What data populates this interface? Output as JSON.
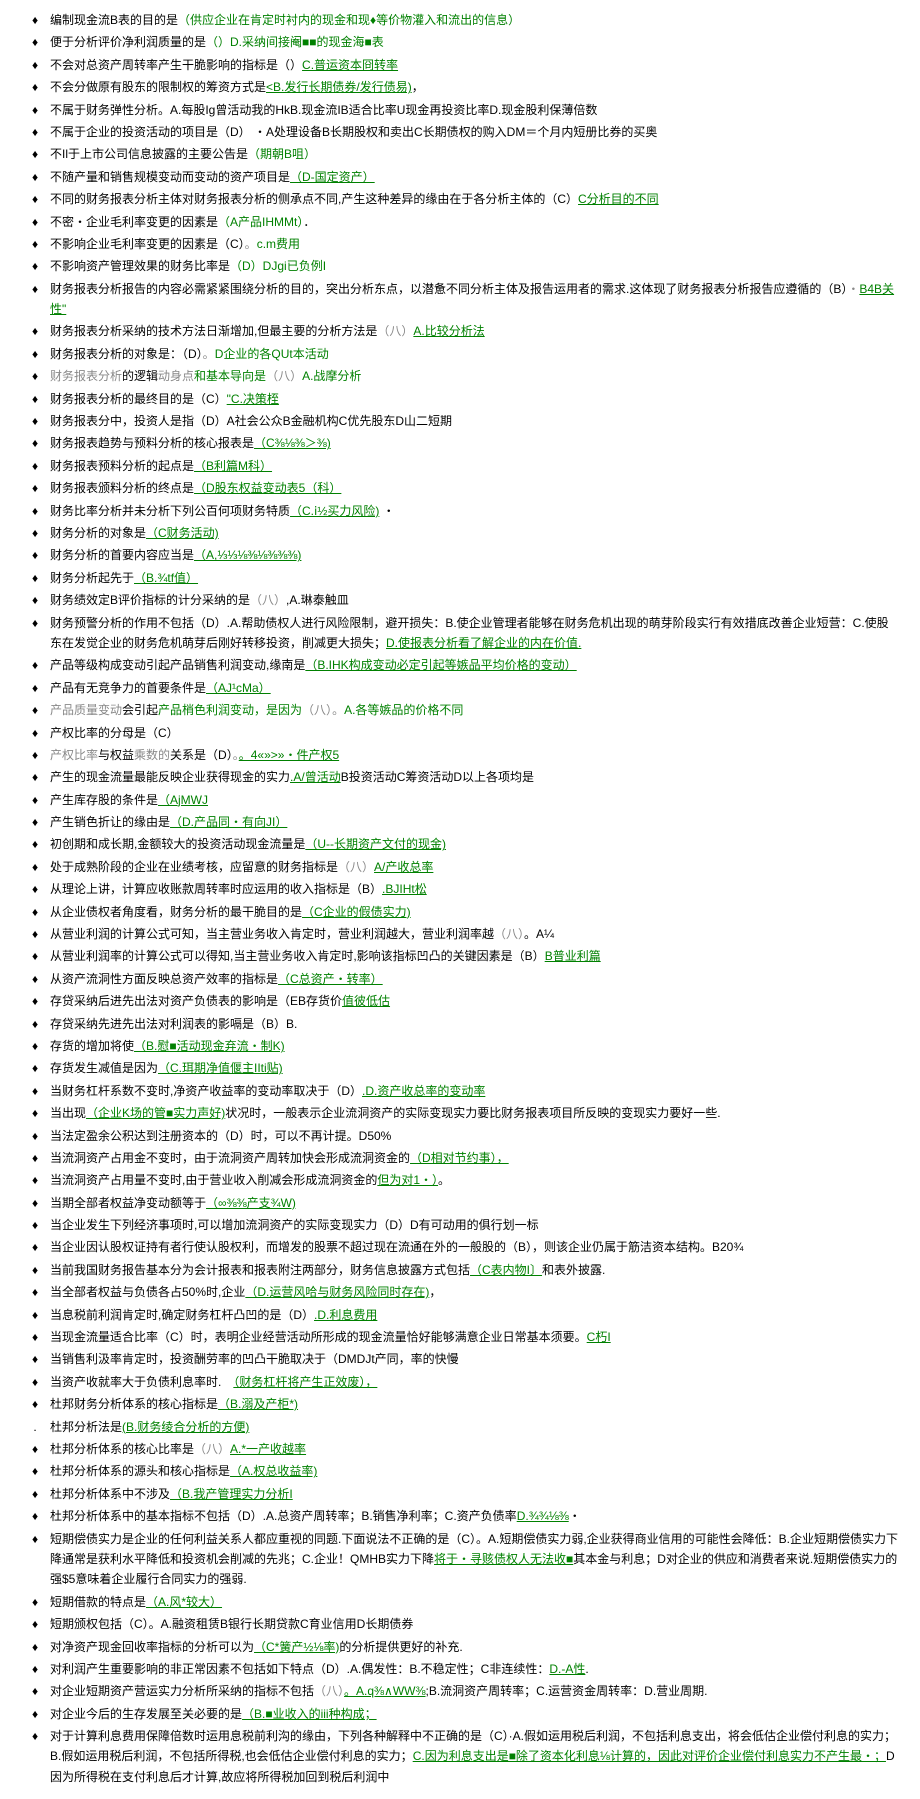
{
  "lines": [
    {
      "bullet": "♦",
      "parts": [
        {
          "t": "编制现金流B表的目的是",
          "c": "black"
        },
        {
          "t": "（供应企业在肯定时衬内的现金和现♦等价物灌入和流出的信息）",
          "c": "green"
        }
      ]
    },
    {
      "bullet": "♦",
      "parts": [
        {
          "t": "便于分析评价净利润质量的是",
          "c": "black"
        },
        {
          "t": "（）D.采纳间接阉■■的现金海■表",
          "c": "green"
        }
      ]
    },
    {
      "bullet": "♦",
      "parts": [
        {
          "t": "不会对总资产周转率产生干脆影响的指标是",
          "c": "black"
        },
        {
          "t": "（）",
          "c": "black"
        },
        {
          "t": "C.普运资本冏转率",
          "c": "green-u"
        }
      ]
    },
    {
      "bullet": "♦",
      "parts": [
        {
          "t": "不会分做原有股东的限制权的筹资方式是",
          "c": "black"
        },
        {
          "t": "<B.发行长期债券/发行债易)",
          "c": "green-u"
        },
        {
          "t": "，",
          "c": "black"
        }
      ]
    },
    {
      "bullet": "♦",
      "parts": [
        {
          "t": "不属于财务弹性分析。A.每股Ig曾活动我的HkB.现金流IB适合比率U现金再投资比率D.现金股利保薄倍数",
          "c": "black"
        }
      ]
    },
    {
      "bullet": "♦",
      "parts": [
        {
          "t": "不属于企业的投资活动的项目是（D）  ・A处理设备B长期股权和卖出C长期债权的购入DM＝个月内短册比券的买奥",
          "c": "black"
        }
      ]
    },
    {
      "bullet": "♦",
      "parts": [
        {
          "t": "不Il于上市公司信息披露的主要公告是",
          "c": "black"
        },
        {
          "t": "（期朝B咀）",
          "c": "green"
        }
      ]
    },
    {
      "bullet": "♦",
      "parts": [
        {
          "t": "不随产量和销售规模变动而变动的资产项目是",
          "c": "black"
        },
        {
          "t": "（D-国定资产）",
          "c": "green-u"
        }
      ]
    },
    {
      "bullet": "♦",
      "parts": [
        {
          "t": "不同的财务报表分析主体对财务报表分析的侧承点不同,产生这种差异的缘由在于各分析主体的（C）",
          "c": "black"
        },
        {
          "t": "C分析目的不同",
          "c": "green-u"
        }
      ]
    },
    {
      "bullet": "♦",
      "parts": [
        {
          "t": "不密・企业毛利率变更的因素是",
          "c": "black"
        },
        {
          "t": "（A产品IHMMt）",
          "c": "green"
        },
        {
          "t": "．",
          "c": "black"
        }
      ]
    },
    {
      "bullet": "♦",
      "parts": [
        {
          "t": "不影响企业毛利率变更的因素是（C）",
          "c": "black"
        },
        {
          "t": "。",
          "c": "gray"
        },
        {
          "t": "c.m费用",
          "c": "green"
        }
      ]
    },
    {
      "bullet": "♦",
      "parts": [
        {
          "t": "不影响资产管理效果的财务比率是",
          "c": "black"
        },
        {
          "t": "（D）DJgi已负例I",
          "c": "green"
        }
      ]
    },
    {
      "bullet": "♦",
      "parts": [
        {
          "t": "财务报表分析报告的内容必需紧紧围绕分析的目的，突出分析东点，以潜惫不同分析主体及报告运用者的需求.这体现了财务报表分析报告应遵循的（B）",
          "c": "black"
        },
        {
          "t": "・",
          "c": "gray"
        },
        {
          "t": "B4B关性\"",
          "c": "green-u"
        }
      ]
    },
    {
      "bullet": "♦",
      "parts": [
        {
          "t": "财务报表分析采纳的技术方法日渐增加,但最主要的分析方法是",
          "c": "black"
        },
        {
          "t": "（八）",
          "c": "gray"
        },
        {
          "t": "A.比较分析法",
          "c": "green-u"
        }
      ]
    },
    {
      "bullet": "♦",
      "parts": [
        {
          "t": "财务报表分析的对象是：（D）",
          "c": "black"
        },
        {
          "t": "。",
          "c": "gray"
        },
        {
          "t": "D企业的各QUt本活动",
          "c": "green"
        }
      ]
    },
    {
      "bullet": "♦",
      "parts": [
        {
          "t": "财务报表分析",
          "c": "gray"
        },
        {
          "t": "的逻辑",
          "c": "black"
        },
        {
          "t": "动身点",
          "c": "gray"
        },
        {
          "t": "和基本导向是",
          "c": "green"
        },
        {
          "t": "（八）",
          "c": "gray"
        },
        {
          "t": "A.战摩分析",
          "c": "green"
        }
      ]
    },
    {
      "bullet": "♦",
      "parts": [
        {
          "t": "财务报表分析的最终目的是（C）",
          "c": "black"
        },
        {
          "t": "\"C.决策桎",
          "c": "green-u"
        }
      ]
    },
    {
      "bullet": "♦",
      "parts": [
        {
          "t": "财务报表分中，投资人是指（D）A社会公众B金融机构C优先股东D山二短期",
          "c": "black"
        }
      ]
    },
    {
      "bullet": "♦",
      "parts": [
        {
          "t": "财务报表趋势与预料分析的核心报表是",
          "c": "black"
        },
        {
          "t": "（C⅜⅛⅜＞⅜)",
          "c": "green-u"
        }
      ]
    },
    {
      "bullet": "♦",
      "parts": [
        {
          "t": "财务报表预料分析的起点是",
          "c": "black"
        },
        {
          "t": "（B利篇M科）",
          "c": "green-u"
        }
      ]
    },
    {
      "bullet": "♦",
      "parts": [
        {
          "t": "财务报表颁料分析的终点是",
          "c": "black"
        },
        {
          "t": "（D股东权益变动表5（科）",
          "c": "green-u"
        }
      ]
    },
    {
      "bullet": "♦",
      "parts": [
        {
          "t": "财务比率分析并未分析下列公百何项财务特质",
          "c": "black"
        },
        {
          "t": "（C.ⅰ½买力风险)",
          "c": "green-u"
        },
        {
          "t": "  ・",
          "c": "black"
        }
      ]
    },
    {
      "bullet": "♦",
      "parts": [
        {
          "t": "财务分析的对象是",
          "c": "black"
        },
        {
          "t": "（C财务活动)",
          "c": "green-u"
        }
      ]
    },
    {
      "bullet": "♦",
      "parts": [
        {
          "t": "财务分析的首要内容应当是",
          "c": "black"
        },
        {
          "t": "（A,⅓⅓⅛⅜⅛⅜⅜⅜)",
          "c": "green-u"
        }
      ]
    },
    {
      "bullet": "♦",
      "parts": [
        {
          "t": "财务分析起先于",
          "c": "black"
        },
        {
          "t": "（B.¾tf值）",
          "c": "green-u"
        }
      ]
    },
    {
      "bullet": "♦",
      "parts": [
        {
          "t": "财务绩效定B评价指标的计分采纳的是",
          "c": "black"
        },
        {
          "t": "（八）",
          "c": "gray"
        },
        {
          "t": ",A.琳泰触皿",
          "c": "black"
        }
      ]
    },
    {
      "bullet": "♦",
      "parts": [
        {
          "t": "财务预警分析的作用不包括（D）.A.帮助债权人进行风险限制，避开损失：B.使企业管理者能够在财务危机出现的萌芽阶段实行有效措底改善企业短营：C.使股东在发觉企业的财务危机萌芽后刚好转移投资，削减更大损失；",
          "c": "black"
        },
        {
          "t": "D.使报表分析看了解企业的内在价值.",
          "c": "green-u"
        }
      ]
    },
    {
      "bullet": "♦",
      "parts": [
        {
          "t": "产品等级构成变动引起产品销售利润变动,缘南是",
          "c": "black"
        },
        {
          "t": "（B.IHK构成变动必定引起等嫉品平均价格的变动）",
          "c": "green-u"
        }
      ]
    },
    {
      "bullet": "♦",
      "parts": [
        {
          "t": "产品有无竞争力的首要条件是",
          "c": "black"
        },
        {
          "t": "（AJ¹cMa）",
          "c": "green-u"
        }
      ]
    },
    {
      "bullet": "♦",
      "parts": [
        {
          "t": "产品质量变动",
          "c": "gray"
        },
        {
          "t": "会引起",
          "c": "black"
        },
        {
          "t": "产品梢色利润变动，是因为",
          "c": "green"
        },
        {
          "t": "（八）",
          "c": "gray"
        },
        {
          "t": "。",
          "c": "gray"
        },
        {
          "t": "A.各等嫉品的价格不同",
          "c": "green"
        }
      ]
    },
    {
      "bullet": "♦",
      "parts": [
        {
          "t": "产权比率的分母是（C）",
          "c": "black"
        }
      ]
    },
    {
      "bullet": "♦",
      "parts": [
        {
          "t": "产权比率",
          "c": "gray"
        },
        {
          "t": "与权益",
          "c": "black"
        },
        {
          "t": "乘数的",
          "c": "gray"
        },
        {
          "t": "关系是（D）",
          "c": "black"
        },
        {
          "t": "。",
          "c": "gray"
        },
        {
          "t": "。4«»>»・件产权5",
          "c": "green-u"
        }
      ]
    },
    {
      "bullet": "♦",
      "parts": [
        {
          "t": "产生的现金流量最能反映企业获得现金的实力",
          "c": "black"
        },
        {
          "t": ".A/曾活动",
          "c": "green-u"
        },
        {
          "t": "B投资活动C筹资活动D以上各项均是",
          "c": "black"
        }
      ]
    },
    {
      "bullet": "♦",
      "parts": [
        {
          "t": "产生库存股的条件是",
          "c": "black"
        },
        {
          "t": "（AjMWJ",
          "c": "green-u"
        }
      ]
    },
    {
      "bullet": "♦",
      "parts": [
        {
          "t": "产生销色折让的缘由是",
          "c": "black"
        },
        {
          "t": "（D.产品同・有向JI）",
          "c": "green-u"
        }
      ]
    },
    {
      "bullet": "♦",
      "parts": [
        {
          "t": "初创期和成长期,金额较大的投资活动现金流量是",
          "c": "black"
        },
        {
          "t": "（U--长期资产文付的现金)",
          "c": "green-u"
        }
      ]
    },
    {
      "bullet": "♦",
      "parts": [
        {
          "t": "处于成熟阶段的企业在业绩考核，应留意的财务指标是",
          "c": "black"
        },
        {
          "t": "（八）",
          "c": "gray"
        },
        {
          "t": "A/产收总率",
          "c": "green-u"
        }
      ]
    },
    {
      "bullet": "♦",
      "parts": [
        {
          "t": "从理论上讲，计算应收账款周转率时应运用的收入指标是（B）",
          "c": "black"
        },
        {
          "t": ".BJIHt松",
          "c": "green-u"
        }
      ]
    },
    {
      "bullet": "♦",
      "parts": [
        {
          "t": "从企业债权者角度看，财务分析的最干脆目的是",
          "c": "black"
        },
        {
          "t": "（C企业的假债实力)",
          "c": "green-u"
        }
      ]
    },
    {
      "bullet": "♦",
      "parts": [
        {
          "t": "从营业利润的计算公式可知，当主营业务收入肯定时，营业利润越大，营业利润率越",
          "c": "black"
        },
        {
          "t": "（八）",
          "c": "gray"
        },
        {
          "t": "。A¼",
          "c": "black"
        }
      ]
    },
    {
      "bullet": "♦",
      "parts": [
        {
          "t": "从营业利润率的计算公式可以得知,当主营业务收入肯定时,影响该指标凹凸的关键因素是（B）",
          "c": "black"
        },
        {
          "t": "B普业利篇",
          "c": "green-u"
        }
      ]
    },
    {
      "bullet": "♦",
      "parts": [
        {
          "t": "从资产流洞性方面反映总资产效率的指标是",
          "c": "black"
        },
        {
          "t": "（C总资产・转率）",
          "c": "green-u"
        }
      ]
    },
    {
      "bullet": "♦",
      "parts": [
        {
          "t": "存贷采纳后进先出法对资产负债表的影响是（EB存货价",
          "c": "black"
        },
        {
          "t": "值彼低估",
          "c": "green-u"
        }
      ]
    },
    {
      "bullet": "♦",
      "parts": [
        {
          "t": "存贷采纳先进先出法对利润表的影嗝是（B）B.",
          "c": "black"
        }
      ]
    },
    {
      "bullet": "♦",
      "parts": [
        {
          "t": "存货的增加将使",
          "c": "black"
        },
        {
          "t": "（B.慰■活动现金弃流・制K)",
          "c": "green-u"
        }
      ]
    },
    {
      "bullet": "♦",
      "parts": [
        {
          "t": "存货发生减值是因为",
          "c": "black"
        },
        {
          "t": "（C.珥期净值偃主IIti贴)",
          "c": "green-u"
        }
      ]
    },
    {
      "bullet": "♦",
      "parts": [
        {
          "t": "当财务杠杆系数不变时,净资产收益率的变动率取决于（D）",
          "c": "black"
        },
        {
          "t": ".D.资产收总率的变动率",
          "c": "green-u"
        }
      ]
    },
    {
      "bullet": "♦",
      "parts": [
        {
          "t": "当出现",
          "c": "black"
        },
        {
          "t": "（企业K场的管■实力声好)",
          "c": "green-u"
        },
        {
          "t": "状况时，一般表示企业流洞资产的实际变现实力要比财务报表项目所反映的变现实力要好一些.",
          "c": "black"
        }
      ]
    },
    {
      "bullet": "♦",
      "parts": [
        {
          "t": "当法定盈余公积达到注册资本的（D）时，可以不再计提。D50%",
          "c": "black"
        }
      ]
    },
    {
      "bullet": "♦",
      "parts": [
        {
          "t": "当流洞资产占用金不变时，由于流洞资产周转加快会形成流洞资金的",
          "c": "black"
        },
        {
          "t": "（D相对节约事），",
          "c": "green-u"
        }
      ]
    },
    {
      "bullet": "♦",
      "parts": [
        {
          "t": "当流洞资产占用量不变时,由于营业收入削减会形成流洞资金的",
          "c": "black"
        },
        {
          "t": "但为对1・）",
          "c": "green-u"
        },
        {
          "t": "。",
          "c": "black"
        }
      ]
    },
    {
      "bullet": "♦",
      "parts": [
        {
          "t": "当期全部者权益净变动额等于",
          "c": "black"
        },
        {
          "t": "（∞⅜⅜产支¾W)",
          "c": "green-u"
        }
      ]
    },
    {
      "bullet": "♦",
      "parts": [
        {
          "t": "当企业发生下列经济事项时,可以增加流洞资产的实际变现实力（D）D有可动用的俱行划一标",
          "c": "black"
        }
      ]
    },
    {
      "bullet": "♦",
      "parts": [
        {
          "t": "当企业因认股权证持有者行使认股权利，而增发的股票不超过现在流通在外的一般股的（B），则该企业仍属于筋洁资本结构。B20¾",
          "c": "black"
        }
      ]
    },
    {
      "bullet": "♦",
      "parts": [
        {
          "t": "当前我国财务报告基本分为会计报表和报表附注两部分，财务信息披露方式包括",
          "c": "black"
        },
        {
          "t": "（C表内物I〕",
          "c": "green-u"
        },
        {
          "t": "和表外披露.",
          "c": "black"
        }
      ]
    },
    {
      "bullet": "♦",
      "parts": [
        {
          "t": "当全部者权益与负债各占50%时,企业",
          "c": "black"
        },
        {
          "t": "（D.运营风哈与财务风险同时存在)",
          "c": "green-u"
        },
        {
          "t": "，",
          "c": "black"
        }
      ]
    },
    {
      "bullet": "♦",
      "parts": [
        {
          "t": "当息税前利润肯定时,确定财务杠杆凸凹的是（D）",
          "c": "black"
        },
        {
          "t": ".D.利息费用",
          "c": "green-u"
        }
      ]
    },
    {
      "bullet": "♦",
      "parts": [
        {
          "t": "当现金流量适合比率（C）时，表明企业经营活动所形成的现金流量恰好能够满意企业日常基本须要。",
          "c": "black"
        },
        {
          "t": "C朽I",
          "c": "green-u"
        }
      ]
    },
    {
      "bullet": "♦",
      "parts": [
        {
          "t": "当销售利汲率肯定时，投资酬劳率的凹凸干脆取决于（DMDJt产同，率的快慢",
          "c": "black"
        }
      ]
    },
    {
      "bullet": "♦",
      "parts": [
        {
          "t": "当资产收就率大于负债利息率时.　",
          "c": "black"
        },
        {
          "t": "（财务杠杆将产生正效废），",
          "c": "green-u"
        }
      ]
    },
    {
      "bullet": "♦",
      "parts": [
        {
          "t": "杜邦财务分析体系的核心指标是",
          "c": "black"
        },
        {
          "t": "（B.溺及产柜*)",
          "c": "green-u"
        }
      ]
    },
    {
      "bullet": ".",
      "parts": [
        {
          "t": "杜邦分析法是",
          "c": "black"
        },
        {
          "t": "(B.财务绫合分析的方便)",
          "c": "green-u"
        }
      ]
    },
    {
      "bullet": "♦",
      "parts": [
        {
          "t": "杜邦分析体系的核心比率是",
          "c": "black"
        },
        {
          "t": "（八）",
          "c": "gray"
        },
        {
          "t": "A.*一产收越率",
          "c": "green-u"
        }
      ]
    },
    {
      "bullet": "♦",
      "parts": [
        {
          "t": "杜邦分析体系的源头和核心指标是",
          "c": "black"
        },
        {
          "t": "（A.权总收益率)",
          "c": "green-u"
        }
      ]
    },
    {
      "bullet": "♦",
      "parts": [
        {
          "t": "杜邦分析体系中不涉及",
          "c": "black"
        },
        {
          "t": "（B.我产管理实力分析I",
          "c": "green-u"
        }
      ]
    },
    {
      "bullet": "♦",
      "parts": [
        {
          "t": "杜邦分析体系中的基本指标不包括（D）.A.总资产周转率；B.销售净利率；C.资产负债率",
          "c": "black"
        },
        {
          "t": "D.¾¾⅛⅜",
          "c": "green-u"
        },
        {
          "t": "・",
          "c": "black"
        }
      ]
    },
    {
      "bullet": "♦",
      "parts": [
        {
          "t": "短期偿债实力是企业的任何利益关系人都应重视的同题.下面说法不正确的是（C）。A.短期偿债实力弱,企业获得商业信用的可能性会降低：B.企业短期偿债实力下降通常是获利水平降低和投资机会削减的先兆；C.企业！QMHB实力下降",
          "c": "black"
        },
        {
          "t": "将于・寻赅债权人无法收■",
          "c": "green-u"
        },
        {
          "t": "其本金与利息；D对企业的供应和消费者来说.短期偿债实力的强$5意味着企业履行合同实力的强弱.",
          "c": "black"
        }
      ]
    },
    {
      "bullet": "♦",
      "parts": [
        {
          "t": "短期借款的特点是",
          "c": "black"
        },
        {
          "t": "（A.风*较大）",
          "c": "green-u"
        }
      ]
    },
    {
      "bullet": "♦",
      "parts": [
        {
          "t": "短期颁权包括（C）。A.融资租赁B银行长期贷款C育业信用D长期债券",
          "c": "black"
        }
      ]
    },
    {
      "bullet": "♦",
      "parts": [
        {
          "t": "对净资产现金回收率指标的分析可以为",
          "c": "black"
        },
        {
          "t": "（C*簧产½⅛率)",
          "c": "green-u"
        },
        {
          "t": "的分析提供更好的补充.",
          "c": "black"
        }
      ]
    },
    {
      "bullet": "♦",
      "parts": [
        {
          "t": "对利润产生重要影响的非正常因素不包括如下特点（D）.A.偶发性：B.不稳定性；C非连续性：",
          "c": "black"
        },
        {
          "t": "D.-A性",
          "c": "green-u"
        },
        {
          "t": ".",
          "c": "black"
        }
      ]
    },
    {
      "bullet": "♦",
      "parts": [
        {
          "t": "对企业短期资产营运实力分析所采纳的指标不包括",
          "c": "black"
        },
        {
          "t": "（八）",
          "c": "gray"
        },
        {
          "t": "。A.q⅜∧WW⅜",
          "c": "green-u"
        },
        {
          "t": ";B.流洞资产周转率；C.运营资金周转率：D.营业周期.",
          "c": "black"
        }
      ]
    },
    {
      "bullet": "♦",
      "parts": [
        {
          "t": "对企业今后的生存发展至关必要的是",
          "c": "black"
        },
        {
          "t": "（B.■业收入的iii种构成；",
          "c": "green-u"
        }
      ]
    },
    {
      "bullet": "♦",
      "parts": [
        {
          "t": "对于计算利息费用保障倍数时运用息税前利沟的缘由，下列各种解释中不正确的是（C）·A.假如运用税后利润，不包括利息支出，将会低估企业偿付利息的实力；B.假如运用税后利润，不包括所得税,也会低估企业偿付利息的实力；",
          "c": "black"
        },
        {
          "t": "C.因为利息支出是■除了资本化利息⅛计算的，因此对评价企业偿付利息实力不产生最・；",
          "c": "green-u"
        },
        {
          "t": "D因为所得税在支付利息后才计算,故应将所得税加回到税后利润中",
          "c": "black"
        }
      ]
    }
  ]
}
